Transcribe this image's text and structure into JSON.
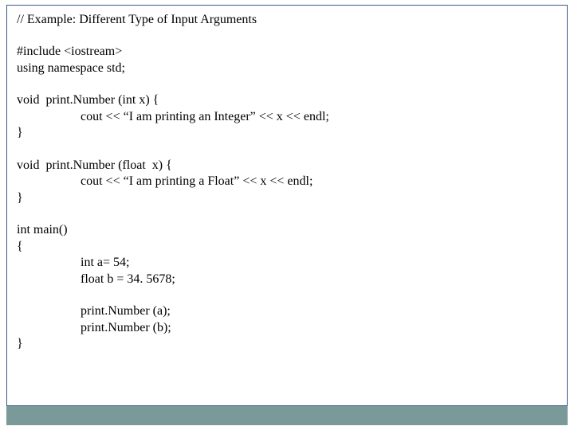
{
  "code": {
    "l1": "// Example: Different Type of Input Arguments",
    "l2": "#include <iostream>",
    "l3": "using namespace std;",
    "l4": "void  print.Number (int x) {",
    "l5": "cout << “I am printing an Integer” << x << endl;",
    "l6": "}",
    "l7": "void  print.Number (float  x) {",
    "l8": "cout << “I am printing a Float” << x << endl;",
    "l9": "}",
    "l10": "int main()",
    "l11": "{",
    "l12": "int a= 54;",
    "l13": "float b = 34. 5678;",
    "l14": "print.Number (a);",
    "l15": "print.Number (b);",
    "l16": "}"
  }
}
